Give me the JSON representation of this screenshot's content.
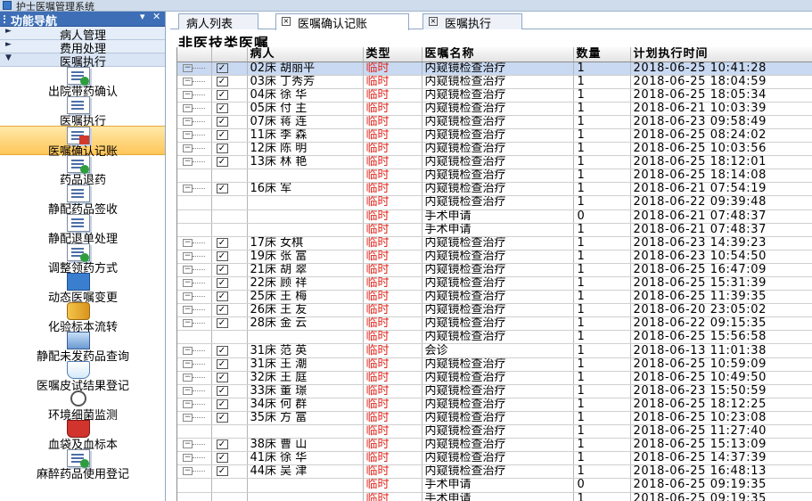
{
  "window": {
    "title": "护士医嘱管理系统"
  },
  "nav": {
    "header": "功能导航",
    "pin": "▾",
    "close": "✕",
    "groups": [
      {
        "arrow": "►",
        "label": "病人管理"
      },
      {
        "arrow": "►",
        "label": "费用处理"
      },
      {
        "arrow": "▼",
        "label": "医嘱执行"
      }
    ],
    "items": [
      {
        "name": "discharge-med-confirm",
        "icon": "document-green-icon",
        "label": "出院带药确认"
      },
      {
        "name": "order-execute",
        "icon": "document-icon",
        "label": "医嘱执行"
      },
      {
        "name": "order-confirm-billing",
        "icon": "document-red-icon",
        "label": "医嘱确认记账",
        "active": true
      },
      {
        "name": "drug-return",
        "icon": "document-green-icon",
        "label": "药品退药"
      },
      {
        "name": "iv-drug-signin",
        "icon": "document-icon",
        "label": "静配药品签收"
      },
      {
        "name": "iv-return-process",
        "icon": "document-icon",
        "label": "静配退单处理"
      },
      {
        "name": "adjust-dispensing",
        "icon": "document-green-icon",
        "label": "调整领药方式"
      },
      {
        "name": "dynamic-order-change",
        "icon": "book-icon",
        "label": "动态医嘱变更"
      },
      {
        "name": "lab-specimen-flow",
        "icon": "pill-bottle-icon",
        "label": "化验标本流转"
      },
      {
        "name": "iv-unsent-query",
        "icon": "box-icon",
        "label": "静配未发药品查询"
      },
      {
        "name": "skin-test-result",
        "icon": "flask-icon",
        "label": "医嘱皮试结果登记"
      },
      {
        "name": "env-bacteria-monitor",
        "icon": "magnifier-icon",
        "label": "环境细菌监测"
      },
      {
        "name": "blood-bag-specimen",
        "icon": "basket-icon",
        "label": "血袋及血标本"
      },
      {
        "name": "anesthetic-usage",
        "icon": "document-green-icon",
        "label": "麻醉药品使用登记"
      }
    ]
  },
  "tabs": [
    {
      "label": "病人列表",
      "closable": false,
      "active": false
    },
    {
      "label": "医嘱确认记账",
      "closable": true,
      "active": true
    },
    {
      "label": "医嘱执行",
      "closable": true,
      "active": false
    }
  ],
  "section_title": "非医技类医嘱",
  "grid": {
    "columns": [
      "",
      "",
      "病人",
      "类型",
      "医嘱名称",
      "数量",
      "计划执行时间"
    ],
    "rows": [
      {
        "expander": true,
        "checked": true,
        "patient": "02床 胡丽平",
        "type": "临时",
        "order": "内窥镜检查治疗",
        "qty": "1",
        "time": "2018-06-25 10:41:28",
        "selected": true
      },
      {
        "expander": true,
        "checked": true,
        "patient": "03床 丁秀芳",
        "type": "临时",
        "order": "内窥镜检查治疗",
        "qty": "1",
        "time": "2018-06-25 18:04:59"
      },
      {
        "expander": true,
        "checked": true,
        "patient": "04床 徐  华",
        "type": "临时",
        "order": "内窥镜检查治疗",
        "qty": "1",
        "time": "2018-06-25 18:05:34"
      },
      {
        "expander": true,
        "checked": true,
        "patient": "05床 付  主",
        "type": "临时",
        "order": "内窥镜检查治疗",
        "qty": "1",
        "time": "2018-06-21 10:03:39"
      },
      {
        "expander": true,
        "checked": true,
        "patient": "07床 蒋  连",
        "type": "临时",
        "order": "内窥镜检查治疗",
        "qty": "1",
        "time": "2018-06-23 09:58:49"
      },
      {
        "expander": true,
        "checked": true,
        "patient": "11床 李  森",
        "type": "临时",
        "order": "内窥镜检查治疗",
        "qty": "1",
        "time": "2018-06-25 08:24:02"
      },
      {
        "expander": true,
        "checked": true,
        "patient": "12床 陈  明",
        "type": "临时",
        "order": "内窥镜检查治疗",
        "qty": "1",
        "time": "2018-06-25 10:03:56"
      },
      {
        "expander": true,
        "checked": true,
        "patient": "13床 林  艳",
        "type": "临时",
        "order": "内窥镜检查治疗",
        "qty": "1",
        "time": "2018-06-25 18:12:01"
      },
      {
        "expander": false,
        "checked": false,
        "patient": "",
        "type": "临时",
        "order": "内窥镜检查治疗",
        "qty": "1",
        "time": "2018-06-25 18:14:08"
      },
      {
        "expander": true,
        "checked": true,
        "patient": "16床  军",
        "type": "临时",
        "order": "内窥镜检查治疗",
        "qty": "1",
        "time": "2018-06-21 07:54:19"
      },
      {
        "expander": false,
        "checked": false,
        "patient": "",
        "type": "临时",
        "order": "内窥镜检查治疗",
        "qty": "1",
        "time": "2018-06-22 09:39:48"
      },
      {
        "expander": false,
        "checked": false,
        "patient": "",
        "type": "临时",
        "order": "手术申请",
        "qty": "0",
        "time": "2018-06-21 07:48:37"
      },
      {
        "expander": false,
        "checked": false,
        "patient": "",
        "type": "临时",
        "order": "手术申请",
        "qty": "1",
        "time": "2018-06-21 07:48:37"
      },
      {
        "expander": true,
        "checked": true,
        "patient": "17床  女棋",
        "type": "临时",
        "order": "内窥镜检查治疗",
        "qty": "1",
        "time": "2018-06-23 14:39:23"
      },
      {
        "expander": true,
        "checked": true,
        "patient": "19床 张  富",
        "type": "临时",
        "order": "内窥镜检查治疗",
        "qty": "1",
        "time": "2018-06-23 10:54:50"
      },
      {
        "expander": true,
        "checked": true,
        "patient": "21床 胡  翠",
        "type": "临时",
        "order": "内窥镜检查治疗",
        "qty": "1",
        "time": "2018-06-25 16:47:09"
      },
      {
        "expander": true,
        "checked": true,
        "patient": "22床 顾  祥",
        "type": "临时",
        "order": "内窥镜检查治疗",
        "qty": "1",
        "time": "2018-06-25 15:31:39"
      },
      {
        "expander": true,
        "checked": true,
        "patient": "25床 王  梅",
        "type": "临时",
        "order": "内窥镜检查治疗",
        "qty": "1",
        "time": "2018-06-25 11:39:35"
      },
      {
        "expander": true,
        "checked": true,
        "patient": "26床 王  友",
        "type": "临时",
        "order": "内窥镜检查治疗",
        "qty": "1",
        "time": "2018-06-20 23:05:02"
      },
      {
        "expander": true,
        "checked": true,
        "patient": "28床 金  云",
        "type": "临时",
        "order": "内窥镜检查治疗",
        "qty": "1",
        "time": "2018-06-22 09:15:35"
      },
      {
        "expander": false,
        "checked": false,
        "patient": "",
        "type": "临时",
        "order": "内窥镜检查治疗",
        "qty": "1",
        "time": "2018-06-25 15:56:58"
      },
      {
        "expander": true,
        "checked": true,
        "patient": "31床 范  英",
        "type": "临时",
        "order": "会诊",
        "qty": "1",
        "time": "2018-06-13 11:01:38"
      },
      {
        "expander": true,
        "checked": true,
        "patient": "31床 王  潮",
        "type": "临时",
        "order": "内窥镜检查治疗",
        "qty": "1",
        "time": "2018-06-25 10:59:09"
      },
      {
        "expander": true,
        "checked": true,
        "patient": "32床 王  庭",
        "type": "临时",
        "order": "内窥镜检查治疗",
        "qty": "1",
        "time": "2018-06-25 10:49:50"
      },
      {
        "expander": true,
        "checked": true,
        "patient": "33床 董  璟",
        "type": "临时",
        "order": "内窥镜检查治疗",
        "qty": "1",
        "time": "2018-06-23 15:50:59"
      },
      {
        "expander": true,
        "checked": true,
        "patient": "34床 何  群",
        "type": "临时",
        "order": "内窥镜检查治疗",
        "qty": "1",
        "time": "2018-06-25 18:12:25"
      },
      {
        "expander": true,
        "checked": true,
        "patient": "35床 方  富",
        "type": "临时",
        "order": "内窥镜检查治疗",
        "qty": "1",
        "time": "2018-06-25 10:23:08"
      },
      {
        "expander": false,
        "checked": false,
        "patient": "",
        "type": "临时",
        "order": "内窥镜检查治疗",
        "qty": "1",
        "time": "2018-06-25 11:27:40"
      },
      {
        "expander": true,
        "checked": true,
        "patient": "38床 曹  山",
        "type": "临时",
        "order": "内窥镜检查治疗",
        "qty": "1",
        "time": "2018-06-25 15:13:09"
      },
      {
        "expander": true,
        "checked": true,
        "patient": "41床 徐  华",
        "type": "临时",
        "order": "内窥镜检查治疗",
        "qty": "1",
        "time": "2018-06-25 14:37:39"
      },
      {
        "expander": true,
        "checked": true,
        "patient": "44床 吴  津",
        "type": "临时",
        "order": "内窥镜检查治疗",
        "qty": "1",
        "time": "2018-06-25 16:48:13"
      },
      {
        "expander": false,
        "checked": false,
        "patient": "",
        "type": "临时",
        "order": "手术申请",
        "qty": "0",
        "time": "2018-06-25 09:19:35"
      },
      {
        "expander": false,
        "checked": false,
        "patient": "",
        "type": "临时",
        "order": "手术申请",
        "qty": "1",
        "time": "2018-06-25 09:19:35"
      }
    ]
  },
  "colors": {
    "nav_header": "#3d6eb6",
    "active_item": "#ffc659",
    "order_type": "#e0251b",
    "selected_row": "#c9d9f2"
  }
}
